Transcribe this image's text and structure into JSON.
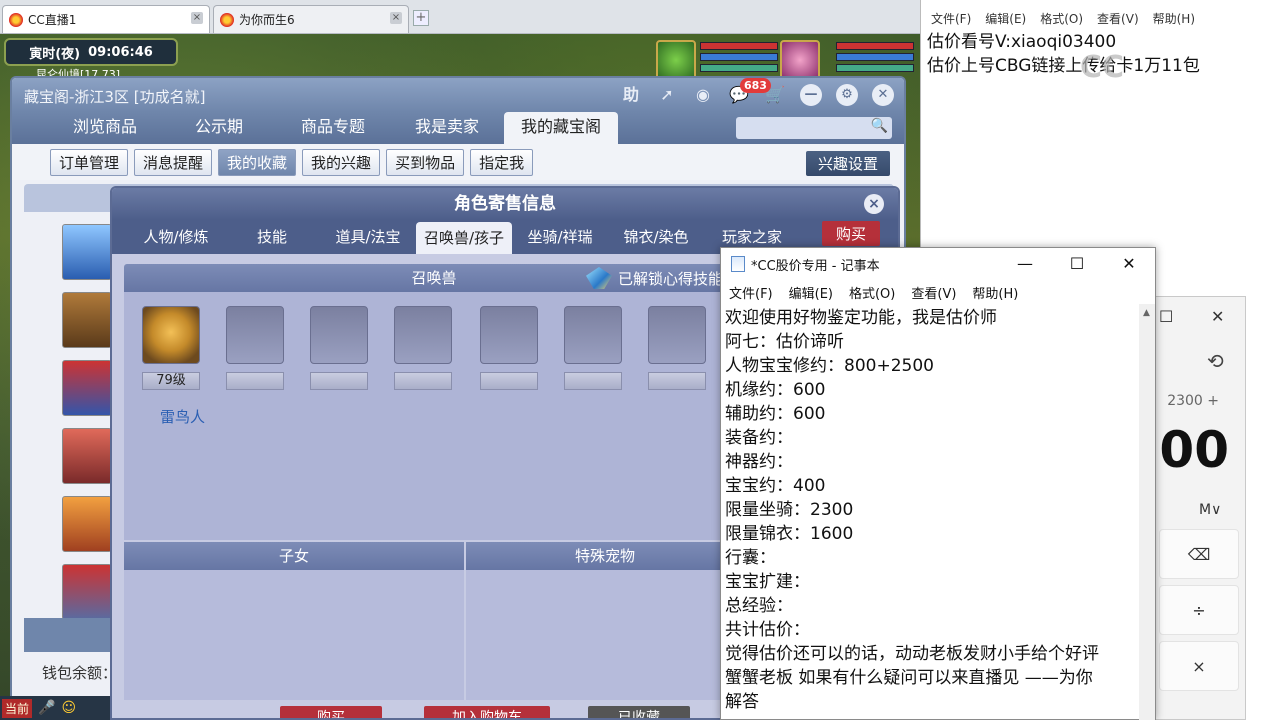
{
  "browser": {
    "tabs": [
      {
        "label": "CC直播1",
        "active": true
      },
      {
        "label": "为你而生6",
        "active": false
      }
    ],
    "tab_close": "×",
    "tab_add": "+"
  },
  "game_hud": {
    "time_label": "寅时(夜)",
    "clock": "09:06:46",
    "coords": "昆仑仙境[17,73]",
    "bottom_label": "当前"
  },
  "cbg": {
    "title": "藏宝阁-浙江3区 [功成名就]",
    "tools": [
      "助",
      "➚",
      "◉",
      "💬",
      "🛒"
    ],
    "message_count": "683",
    "nav_tabs": [
      "浏览商品",
      "公示期",
      "商品专题",
      "我是卖家",
      "我的藏宝阁"
    ],
    "active_nav": 4,
    "search_placeholder": "",
    "sub_buttons": [
      "订单管理",
      "消息提醒",
      "我的收藏",
      "我的兴趣",
      "买到物品",
      "指定我"
    ],
    "active_sub": 2,
    "interest_setting": "兴趣设置",
    "wallet_label": "钱包余额："
  },
  "role_dialog": {
    "title": "角色寄售信息",
    "close": "×",
    "tabs": [
      "人物/修炼",
      "技能",
      "道具/法宝",
      "召唤兽/孩子",
      "坐骑/祥瑞",
      "锦衣/染色",
      "玩家之家"
    ],
    "active_tab": 3,
    "buy_top": "购买",
    "summon_header": "召唤兽",
    "unlock_text": "已解锁心得技能",
    "pet": {
      "level": "79级",
      "name": "雷鸟人"
    },
    "empty_slots": 6,
    "children_header": "子女",
    "special_header": "特殊宠物",
    "buttons": [
      "购买",
      "加入购物车",
      "已收藏"
    ],
    "colors": {
      "buy": "#b5303a",
      "cart": "#b5303a",
      "collected": "#555555"
    }
  },
  "notepad_back": {
    "menu": [
      "文件(F)",
      "编辑(E)",
      "格式(O)",
      "查看(V)",
      "帮助(H)"
    ],
    "lines": [
      "估价看号V:xiaoqi03400",
      "估价上号CBG链接上传给卡1万11包"
    ]
  },
  "notepad_front": {
    "title": "*CC股价专用 - 记事本",
    "controls": [
      "—",
      "☐",
      "✕"
    ],
    "menu": [
      "文件(F)",
      "编辑(E)",
      "格式(O)",
      "查看(V)",
      "帮助(H)"
    ],
    "lines": [
      "欢迎使用好物鉴定功能，我是估价师",
      "阿七：估价谛听",
      "人物宝宝修约：800+2500",
      "机缘约：600",
      "辅助约：600",
      "装备约：",
      "神器约：",
      "宝宝约：400",
      "限量坐骑：2300",
      "限量锦衣：1600",
      "行囊：",
      "宝宝扩建：",
      "总经验：",
      "共计估价：",
      "觉得估价还可以的话，动动老板发财小手给个好评",
      "蟹蟹老板 如果有什么疑问可以来直播见 ——为你",
      "解答"
    ]
  },
  "calculator": {
    "controls": [
      "☐",
      "✕"
    ],
    "history_icon": "history-icon",
    "expression": "2300 +",
    "result": "300",
    "memory": "M∨",
    "keys": [
      "⌫",
      "÷",
      "×"
    ]
  }
}
